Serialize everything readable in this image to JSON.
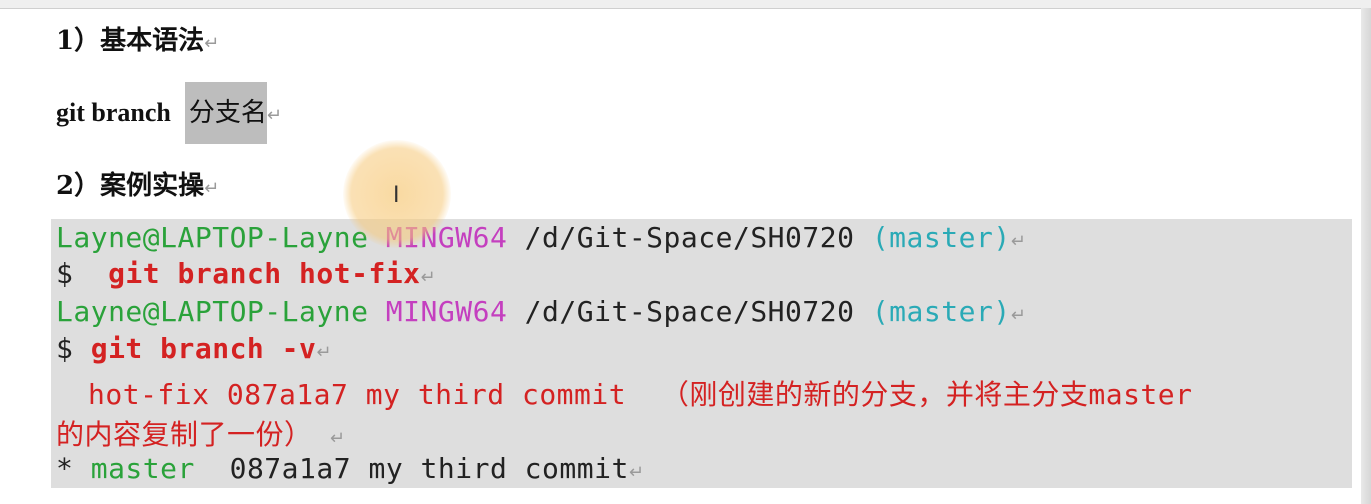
{
  "section1": {
    "heading": "1）基本语法"
  },
  "syntax": {
    "command": "git branch",
    "placeholder": "分支名"
  },
  "section2": {
    "heading": "2）案例实操"
  },
  "terminal": {
    "prompt1": {
      "user_host": "Layne@LAPTOP-Layne",
      "env": "MINGW64",
      "path": "/d/Git-Space/SH0720",
      "branch": "(master)"
    },
    "cmd1": {
      "symbol": "$",
      "text": "git branch hot-fix"
    },
    "prompt2": {
      "user_host": "Layne@LAPTOP-Layne",
      "env": "MINGW64",
      "path": "/d/Git-Space/SH0720",
      "branch": "(master)"
    },
    "cmd2": {
      "symbol": "$",
      "text": "git branch -v"
    },
    "out1": {
      "branch": "hot-fix",
      "hash": "087a1a7",
      "message": "my third commit",
      "note_part1": "（刚创建的新的分支，并将主分支",
      "note_master": "master",
      "note_part2": "的内容复制了一份）"
    },
    "out2": {
      "star": "*",
      "branch": "master",
      "hash": "087a1a7",
      "message": "my third commit"
    }
  },
  "cursor": {
    "glyph": "I"
  },
  "paragraph_mark": "↵"
}
